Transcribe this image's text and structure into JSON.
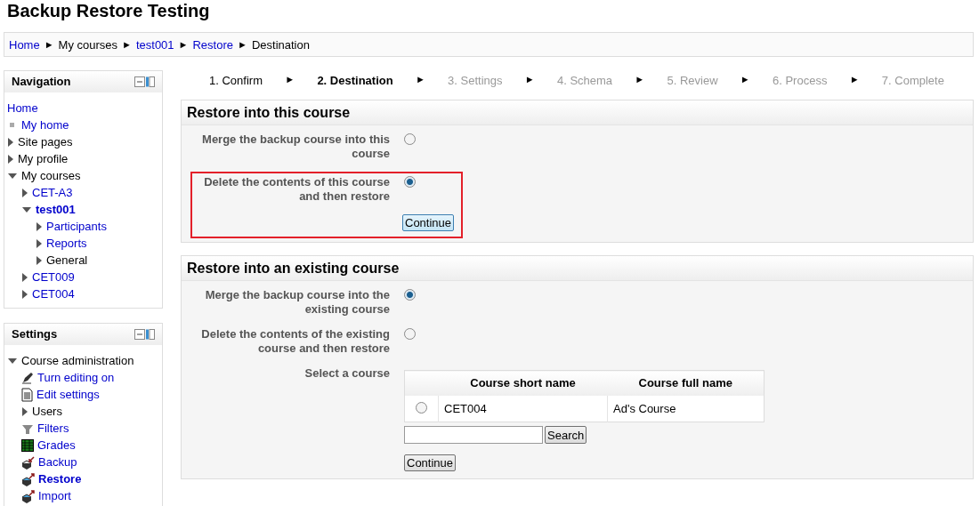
{
  "page_title": "Backup Restore Testing",
  "breadcrumb": [
    {
      "label": "Home",
      "link": true,
      "arrow": "►"
    },
    {
      "label": "My courses",
      "link": false,
      "arrow": "►"
    },
    {
      "label": "test001",
      "link": true,
      "arrow": "►"
    },
    {
      "label": "Restore",
      "link": true,
      "arrow": "►"
    },
    {
      "label": "Destination",
      "link": false
    }
  ],
  "navigation": {
    "title": "Navigation",
    "items": [
      {
        "label": "Home",
        "kind": "root",
        "link": true
      },
      {
        "label": "My home",
        "kind": "leaf",
        "link": true
      },
      {
        "label": "Site pages",
        "kind": "branch",
        "link": false,
        "expanded": false
      },
      {
        "label": "My profile",
        "kind": "branch",
        "link": false,
        "expanded": false
      },
      {
        "label": "My courses",
        "kind": "branch",
        "link": false,
        "expanded": true,
        "children": [
          {
            "label": "CET-A3",
            "kind": "branch",
            "link": true,
            "expanded": false
          },
          {
            "label": "test001",
            "kind": "branch",
            "link": true,
            "expanded": true,
            "current": true,
            "children": [
              {
                "label": "Participants",
                "kind": "branch",
                "link": true,
                "expanded": false
              },
              {
                "label": "Reports",
                "kind": "branch",
                "link": true,
                "expanded": false
              },
              {
                "label": "General",
                "kind": "branch",
                "link": false,
                "expanded": false
              }
            ]
          },
          {
            "label": "CET009",
            "kind": "branch",
            "link": true,
            "expanded": false
          },
          {
            "label": "CET004",
            "kind": "branch",
            "link": true,
            "expanded": false
          }
        ]
      }
    ]
  },
  "settings": {
    "title": "Settings",
    "items": [
      {
        "label": "Course administration",
        "kind": "branch",
        "link": false,
        "expanded": true,
        "children": [
          {
            "label": "Turn editing on",
            "kind": "edit",
            "link": true
          },
          {
            "label": "Edit settings",
            "kind": "document",
            "link": true
          },
          {
            "label": "Users",
            "kind": "branch",
            "link": false,
            "expanded": false
          },
          {
            "label": "Filters",
            "kind": "filter",
            "link": true
          },
          {
            "label": "Grades",
            "kind": "grades",
            "link": true
          },
          {
            "label": "Backup",
            "kind": "backup",
            "link": true
          },
          {
            "label": "Restore",
            "kind": "restore",
            "link": true,
            "current": true
          },
          {
            "label": "Import",
            "kind": "restore",
            "link": true
          }
        ]
      }
    ]
  },
  "steps": [
    {
      "label": "1. Confirm",
      "selected": false,
      "disabled": false,
      "arrow": "►"
    },
    {
      "label": "2. Destination",
      "selected": true,
      "disabled": false,
      "arrow": "►"
    },
    {
      "label": "3. Settings",
      "selected": false,
      "disabled": true,
      "arrow": "►"
    },
    {
      "label": "4. Schema",
      "selected": false,
      "disabled": true,
      "arrow": "►"
    },
    {
      "label": "5. Review",
      "selected": false,
      "disabled": true,
      "arrow": "►"
    },
    {
      "label": "6. Process",
      "selected": false,
      "disabled": true,
      "arrow": "►"
    },
    {
      "label": "7. Complete",
      "selected": false,
      "disabled": true
    }
  ],
  "sections": [
    {
      "title": "Restore into this course",
      "highlighted": true,
      "options": [
        {
          "label": "Merge the backup course into this course",
          "selected": false
        },
        {
          "label": "Delete the contents of this course and then restore",
          "selected": true
        }
      ],
      "button": "Continue"
    },
    {
      "title": "Restore into an existing course",
      "highlighted": false,
      "options": [
        {
          "label": "Merge the backup course into the existing course",
          "selected": true
        },
        {
          "label": "Delete the contents of the existing course and then restore",
          "selected": false
        }
      ],
      "select_label": "Select a course",
      "table": {
        "columns": [
          "Course short name",
          "Course full name"
        ],
        "rows": [
          {
            "short_name": "CET004",
            "full_name": "Ad's Course",
            "selected": false
          }
        ]
      },
      "search_button": "Search",
      "button": "Continue"
    }
  ]
}
